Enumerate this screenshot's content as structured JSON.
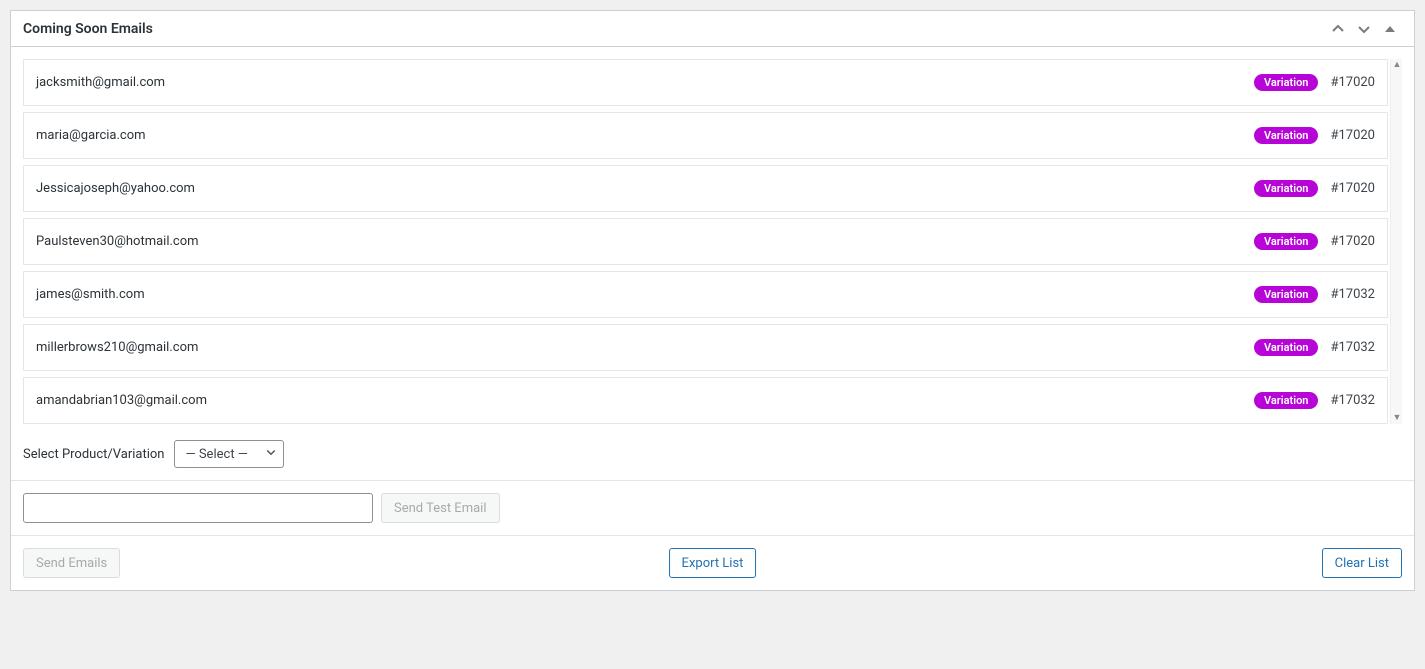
{
  "panel": {
    "title": "Coming Soon Emails"
  },
  "emails": [
    {
      "address": "jacksmith@gmail.com",
      "badge": "Variation",
      "id": "#17020"
    },
    {
      "address": "maria@garcia.com",
      "badge": "Variation",
      "id": "#17020"
    },
    {
      "address": "Jessicajoseph@yahoo.com",
      "badge": "Variation",
      "id": "#17020"
    },
    {
      "address": "Paulsteven30@hotmail.com",
      "badge": "Variation",
      "id": "#17020"
    },
    {
      "address": "james@smith.com",
      "badge": "Variation",
      "id": "#17032"
    },
    {
      "address": "millerbrows210@gmail.com",
      "badge": "Variation",
      "id": "#17032"
    },
    {
      "address": "amandabrian103@gmail.com",
      "badge": "Variation",
      "id": "#17032"
    }
  ],
  "select": {
    "label": "Select Product/Variation",
    "value": "— Select —"
  },
  "test": {
    "input_value": "",
    "send_test_label": "Send Test Email"
  },
  "footer": {
    "send_emails_label": "Send Emails",
    "export_list_label": "Export List",
    "clear_list_label": "Clear List"
  },
  "colors": {
    "badge": "#b705d7",
    "primary": "#2271b1"
  }
}
